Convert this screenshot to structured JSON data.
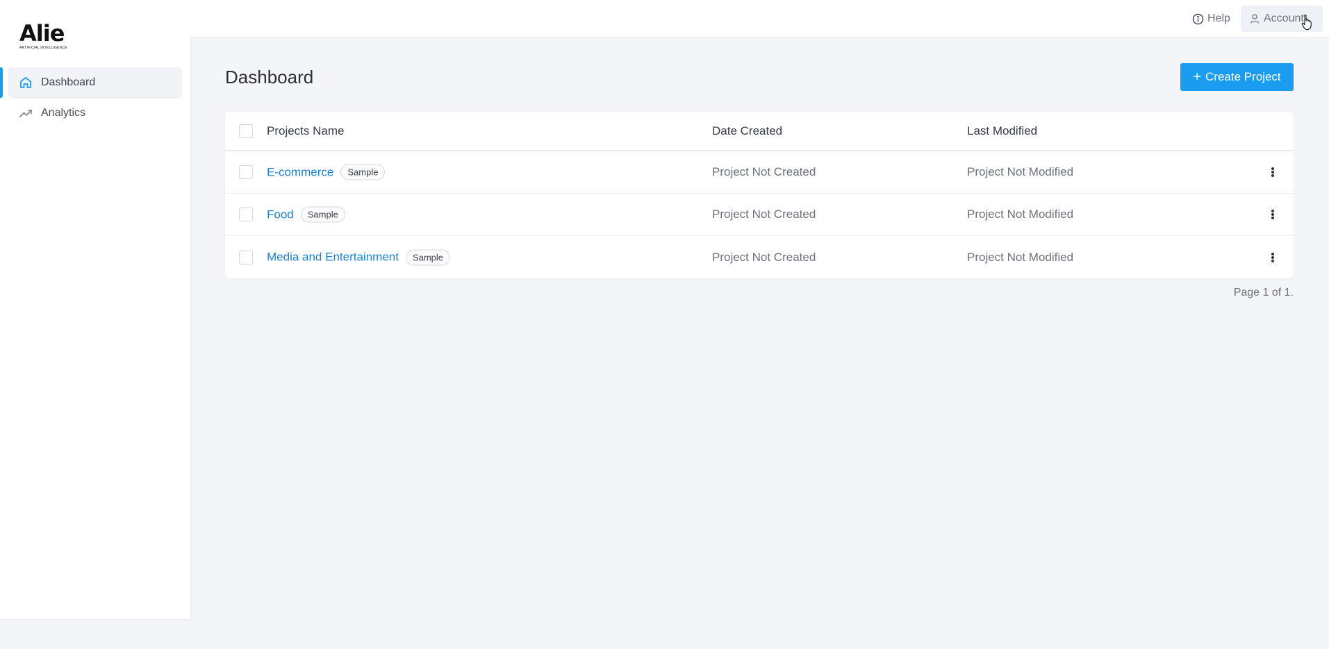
{
  "brand": {
    "name": "Alie",
    "tagline": "ARTIFICIAL INTELLIGENCE"
  },
  "sidebar": {
    "items": [
      {
        "label": "Dashboard",
        "icon": "home-icon",
        "active": true
      },
      {
        "label": "Analytics",
        "icon": "trending-up-icon",
        "active": false
      }
    ]
  },
  "topbar": {
    "help_label": "Help",
    "account_label": "Account"
  },
  "main": {
    "title": "Dashboard",
    "create_label": "Create Project",
    "table": {
      "headers": {
        "name": "Projects Name",
        "date": "Date Created",
        "modified": "Last Modified"
      },
      "rows": [
        {
          "name": "E-commerce",
          "badge": "Sample",
          "date": "Project Not Created",
          "modified": "Project Not Modified"
        },
        {
          "name": "Food",
          "badge": "Sample",
          "date": "Project Not Created",
          "modified": "Project Not Modified"
        },
        {
          "name": "Media and Entertainment",
          "badge": "Sample",
          "date": "Project Not Created",
          "modified": "Project Not Modified"
        }
      ]
    },
    "pagination": "Page 1 of 1."
  },
  "colors": {
    "accent": "#1a9cf0",
    "link": "#1a82d6",
    "background": "#f4f5f8"
  }
}
